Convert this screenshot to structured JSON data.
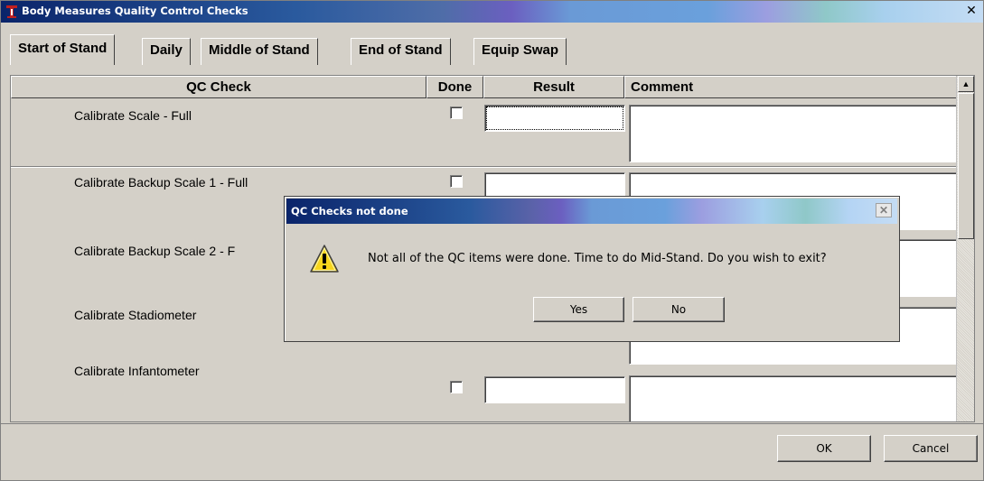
{
  "window": {
    "title": "Body Measures Quality Control Checks",
    "close_glyph": "✕"
  },
  "tabs": [
    {
      "label": "Start of Stand",
      "active": true
    },
    {
      "label": "Daily",
      "active": false
    },
    {
      "label": "Middle of Stand",
      "active": false
    },
    {
      "label": "End of Stand",
      "active": false
    },
    {
      "label": "Equip Swap",
      "active": false
    }
  ],
  "grid": {
    "headers": {
      "qc_check": "QC Check",
      "done": "Done",
      "result": "Result",
      "comment": "Comment"
    },
    "rows": [
      {
        "label": "Calibrate Scale - Full",
        "done": false,
        "result": "",
        "comment": ""
      },
      {
        "label": "Calibrate Backup Scale 1 - Full",
        "done": false,
        "result": "",
        "comment": ""
      },
      {
        "label": "Calibrate Backup Scale 2 - F",
        "done": false,
        "result": "",
        "comment": ""
      },
      {
        "label": "Calibrate Stadiometer",
        "done": false,
        "result": "",
        "comment": ""
      },
      {
        "label": "Calibrate Infantometer",
        "done": false,
        "result": "",
        "comment": ""
      }
    ]
  },
  "footer": {
    "ok_label": "OK",
    "cancel_label": "Cancel"
  },
  "dialog": {
    "title": "QC Checks not done",
    "message": "Not all of the QC items were done. Time to do Mid-Stand. Do you wish to exit?",
    "yes_label": "Yes",
    "no_label": "No",
    "icon": "warning-icon",
    "close_glyph": "✕"
  },
  "colors": {
    "title_start": "#0a246a",
    "face": "#d4d0c8",
    "warning_yellow": "#f7d51d"
  }
}
